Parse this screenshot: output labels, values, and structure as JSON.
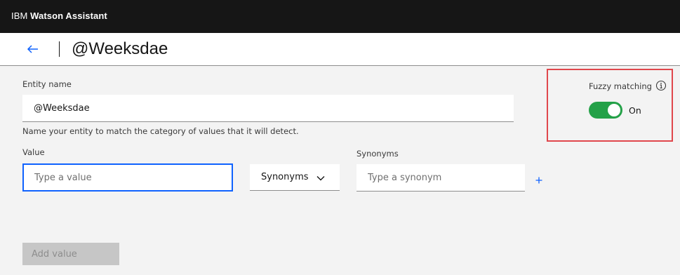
{
  "topbar": {
    "brand_prefix": "IBM",
    "brand_name": "Watson Assistant"
  },
  "header": {
    "back_icon": "arrow-left-icon",
    "title": "@Weeksdae"
  },
  "entity": {
    "name_label": "Entity name",
    "name_value": "@Weeksdae",
    "helper_text": "Name your entity to match the category of values that it will detect."
  },
  "value": {
    "label": "Value",
    "placeholder": "Type a value"
  },
  "type_dropdown": {
    "selected": "Synonyms",
    "icon": "chevron-down-icon"
  },
  "synonyms": {
    "label": "Synonyms",
    "placeholder": "Type a synonym",
    "add_icon": "plus-icon"
  },
  "add_value_button": {
    "label": "Add value"
  },
  "fuzzy_matching": {
    "label": "Fuzzy matching",
    "info_icon": "info-icon",
    "state_label": "On",
    "enabled": true
  },
  "colors": {
    "topbar": "#161616",
    "focus": "#0f62fe",
    "toggle_on": "#24a148",
    "highlight_box": "#e0474c"
  }
}
